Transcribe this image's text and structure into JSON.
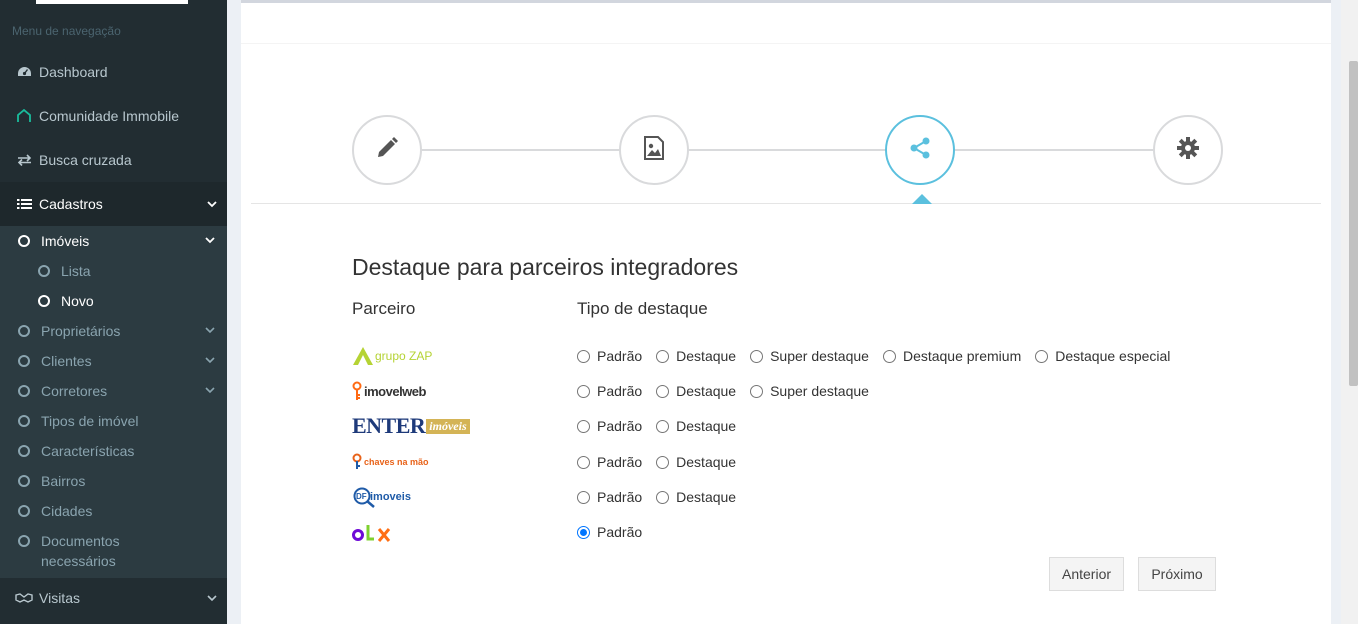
{
  "sidebar": {
    "header": "Menu de navegação",
    "items": [
      {
        "label": "Dashboard",
        "icon": "dashboard-icon"
      },
      {
        "label": "Comunidade Immobile",
        "icon": "house-icon"
      },
      {
        "label": "Busca cruzada",
        "icon": "exchange-icon"
      },
      {
        "label": "Cadastros",
        "icon": "list-icon"
      },
      {
        "label": "Visitas",
        "icon": "handshake-icon"
      }
    ],
    "cadastros": {
      "imoveis": "Imóveis",
      "lista": "Lista",
      "novo": "Novo",
      "proprietarios": "Proprietários",
      "clientes": "Clientes",
      "corretores": "Corretores",
      "tipos": "Tipos de imóvel",
      "caracteristicas": "Características",
      "bairros": "Bairros",
      "cidades": "Cidades",
      "documentos": "Documentos necessários"
    }
  },
  "wizard": {
    "steps": [
      "edit-step",
      "image-step",
      "share-step",
      "settings-step"
    ],
    "active_step": 3,
    "accent_color": "#5bc0de"
  },
  "form": {
    "title": "Destaque para parceiros integradores",
    "col_partner": "Parceiro",
    "col_type": "Tipo de destaque",
    "partners": [
      {
        "name": "grupo zap",
        "logo_text": "grupo ZAP",
        "options": [
          "Padrão",
          "Destaque",
          "Super destaque",
          "Destaque premium",
          "Destaque especial"
        ],
        "selected": null
      },
      {
        "name": "imovelweb",
        "logo_text": "imovelweb",
        "options": [
          "Padrão",
          "Destaque",
          "Super destaque"
        ],
        "selected": null
      },
      {
        "name": "enter imoveis",
        "logo_text": "ENTER",
        "logo_text2": "imóveis",
        "options": [
          "Padrão",
          "Destaque"
        ],
        "selected": null
      },
      {
        "name": "chaves na mao",
        "logo_text": "chaves na mão",
        "options": [
          "Padrão",
          "Destaque"
        ],
        "selected": null
      },
      {
        "name": "df imoveis",
        "logo_text": "DF",
        "logo_text2": "imoveis",
        "options": [
          "Padrão",
          "Destaque"
        ],
        "selected": null
      },
      {
        "name": "olx",
        "logo_text": "OLX",
        "options": [
          "Padrão"
        ],
        "selected": "Padrão"
      }
    ],
    "btn_prev": "Anterior",
    "btn_next": "Próximo"
  }
}
